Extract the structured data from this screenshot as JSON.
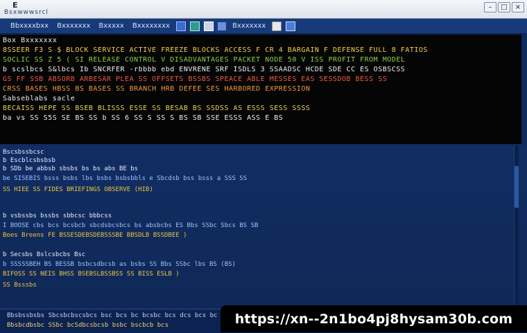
{
  "window": {
    "title": "E",
    "subtitle": "Bsxwwwsrcl",
    "controls": [
      "–",
      "□",
      "×"
    ]
  },
  "toolbar": {
    "items": [
      "Bbxxxxbxx",
      "Bxxxxxxx",
      "Bxxxxx",
      "Bxxxxxxxx",
      "Bxxxxxxx"
    ],
    "icons": [
      "folder-icon",
      "refresh-icon",
      "doc-icon",
      "filter-icon",
      "page-icon",
      "monitor-icon"
    ]
  },
  "log": {
    "lines": [
      {
        "text": "Box  Bxxxxxxx",
        "color": "white"
      },
      {
        "text": "8SSEER  F3   S  $  BLOCK SERVICE ACTIVE  FREEZE  BLOCKS ACCESS  F  CR  4 BARGAIN  F DEFENSE FULL  8  FATIOS",
        "color": "yellow"
      },
      {
        "text": "SOCLIC  SS  Z 5 ( SI  RELEASE CONTROL  V  DISADVANTAGES  PACKET NODE 50  V  ISS  PROFIT  FROM  MODEL",
        "color": "green"
      },
      {
        "text": "b scslbcs   S&lbcs  Ib  SNCRFER  -rbbbb ebd   ENVRENE SRF ISDLS  3 SSAADSC HCDE SDE  CC  ES  OSBSCSS",
        "color": "white"
      },
      {
        "text": "GS  FF SSB ABSORB  ARBESAR  PLEA SS OFFSETS  BSSBS  SPEACE  ABLE  MESSES  EAS  SESSDOB  BESS SS",
        "color": "red"
      },
      {
        "text": "CRSS    BASES  HBSS  BS  BASES SS  BRANCH HRB  DEFEE  SES  HARBORED  EXPRESSION",
        "color": "orange"
      },
      {
        "text": "Sabseblabs sacle                                                              ",
        "color": "white"
      },
      {
        "text": "BECAISS  HEPE SS  BSEB  BLISSS  ESSE SS  BESAB  BS  SSDSS  AS  ESSS  SESS  SSSS",
        "color": "yellow"
      },
      {
        "text": "ba   vs  SS  S5S  SE  BS  SS  b  SS  6  SS  S  SS  S  BS  SB  SSE  ESSS  ASS  E  BS",
        "color": "white"
      }
    ]
  },
  "detail": {
    "rows": [
      {
        "text": "Bscsbssbcsc",
        "style": "small"
      },
      {
        "text": "b Escblcsbsbsb",
        "style": "small"
      },
      {
        "text": "b SDb  be  abbsb  sbsbs  bs  bs  abs  BE  bs",
        "style": "small"
      },
      {
        "text": "be   SISEBIS  bsss  bsbs  lbs  bsbs  bsbsbbls  e  Sbcdsb bss  bsss  a  SSS  SS",
        "style": "info"
      },
      {
        "text": "SS   HIEE  SS  FIDES  BRIEFINGS OBSERVE (HIB)",
        "style": "warn"
      },
      {
        "text": "b  vsbssbs bssbs sbbcsc bbbcss",
        "style": "small"
      },
      {
        "text": "I  BOOSE  cbs  bcs  bcsbcb  sbcdsbcsbcs  bs  absbcbs  ES  Bbs  SSbc  Sbcs  BS  SB",
        "style": "info"
      },
      {
        "text": "Boes  Breens  FE    BSSESDEBSDEBSSSBE  BBSDLB  BSSDBEE )",
        "style": "warn"
      },
      {
        "text": "b  Secsbs  Bslcsbcbs  Bsc",
        "style": "small"
      },
      {
        "text": "b SSSSSBEH  BS   BESSB  bsbcsdbcsb  as  bsbs  SS  Bbs  SSbc  lbs  BS (BS)",
        "style": "info"
      },
      {
        "text": "BIFOSS  SS  NEIS  BHSS  BSEBSLBSSBSS  SS  BISS  ESLB )",
        "style": "warn"
      },
      {
        "text": "SS   Bsssbs",
        "style": "warn"
      }
    ]
  },
  "status": {
    "line1": "Bbsbssbsbs  Sbcsbcbscsbcs  bsc  bcs  bc  bcsbc  bcs  dcs  bcs  bc",
    "line2": "Bbsbcdbsbc  SSbc  bcSdbcsbcsb  bsbc  bscbcb  bcs"
  },
  "banner": {
    "url": "https://xn--2n1bo4pj8hysam30b.com"
  }
}
